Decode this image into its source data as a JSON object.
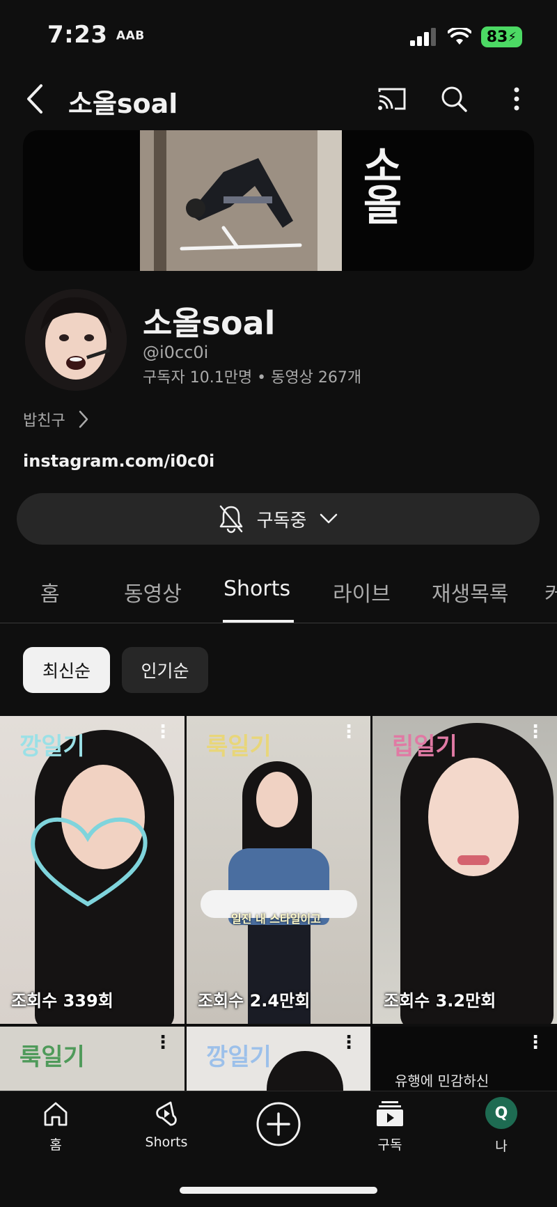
{
  "status": {
    "time": "7:23",
    "time_badge": "AAB",
    "battery": "83"
  },
  "header": {
    "title": "소올soal"
  },
  "banner": {
    "text": "소올"
  },
  "channel": {
    "name": "소올soal",
    "handle": "@i0cc0i",
    "stats": "구독자 10.1만명 • 동영상 267개",
    "friend_label": "밥친구",
    "link": "instagram.com/i0c0i",
    "subscribe_label": "구독중"
  },
  "tabs": [
    {
      "label": "홈"
    },
    {
      "label": "동영상"
    },
    {
      "label": "Shorts"
    },
    {
      "label": "라이브"
    },
    {
      "label": "재생목록"
    },
    {
      "label": "커"
    }
  ],
  "sort": {
    "newest": "최신순",
    "popular": "인기순"
  },
  "shorts": [
    {
      "title": "깡일기",
      "views": "조회수 339회"
    },
    {
      "title": "룩일기",
      "views": "조회수 2.4만회",
      "caption": "일진 내 스타일이고"
    },
    {
      "title": "립일기",
      "views": "조회수 3.2만회"
    },
    {
      "title": "룩일기",
      "views": ""
    },
    {
      "title": "깡일기",
      "views": ""
    },
    {
      "title": "",
      "views": "",
      "caption": "유행에 민감하신"
    }
  ],
  "nav": {
    "home": "홈",
    "shorts": "Shorts",
    "subscriptions": "구독",
    "you": "나",
    "avatar_letter": "Q"
  },
  "colors": {
    "background": "#0f0f0f",
    "battery": "#4cd964",
    "avatar": "#1e6b52"
  }
}
